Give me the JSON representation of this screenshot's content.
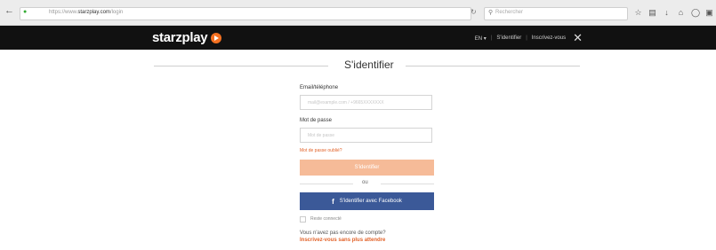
{
  "browser": {
    "url_prefix": "https://www.",
    "url_domain": "starzplay.com",
    "url_suffix": "/login",
    "search_placeholder": "Rechercher",
    "reload_icon": "reload-icon",
    "toolbar_icons": [
      "star-icon",
      "reading-list-icon",
      "download-icon",
      "home-icon",
      "sync-icon",
      "pocket-icon",
      "menu-icon"
    ]
  },
  "header": {
    "logo_text": "starzplay",
    "language": "EN",
    "signin_link": "S'identifier",
    "signup_link": "Inscrivez-vous",
    "brand_color": "#f37021"
  },
  "login": {
    "title": "S'identifier",
    "email_label": "Email/téléphone",
    "email_placeholder": "mail@example.com / +9665XXXXXXX",
    "password_label": "Mot de passe",
    "password_placeholder": "Mot de passe",
    "forgot_link": "Mot de passe oublié?",
    "submit_label": "S'identifier",
    "or_text": "ou",
    "facebook_label": "S'identifier avec Facebook",
    "remember_label": "Reste connecté",
    "no_account_text": "Vous n'avez pas encore de compte?",
    "signup_cta": "Inscrivez-vous sans plus attendre"
  }
}
